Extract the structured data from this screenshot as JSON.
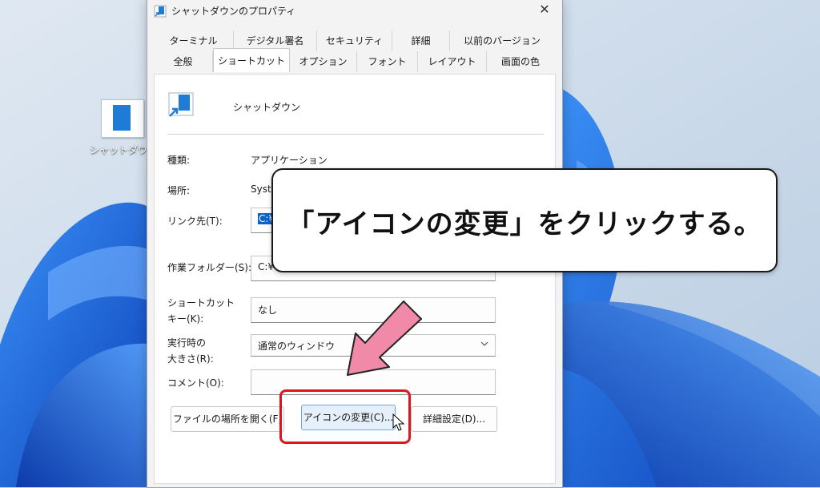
{
  "desktop": {
    "icon_label": "シャットダウン"
  },
  "dialog": {
    "title": "シャットダウンのプロパティ",
    "close_glyph": "✕",
    "tabs_back": [
      "ターミナル",
      "デジタル署名",
      "セキュリティ",
      "詳細",
      "以前のバージョン"
    ],
    "tabs_front": [
      "全般",
      "ショートカット",
      "オプション",
      "フォント",
      "レイアウト",
      "画面の色"
    ],
    "selected_tab": "ショートカット",
    "shortcut_name": "シャットダウン",
    "fields": {
      "type_label": "種類:",
      "type_value": "アプリケーション",
      "location_label": "場所:",
      "location_value": "Syste",
      "target_label": "リンク先(T):",
      "target_value": "C:¥W",
      "startin_label": "作業フォルダー(S):",
      "startin_value": "C:¥W",
      "hotkey_label_1": "ショートカット",
      "hotkey_label_2": "キー(K):",
      "hotkey_value": "なし",
      "run_label_1": "実行時の",
      "run_label_2": "大きさ(R):",
      "run_value": "通常のウィンドウ",
      "comment_label": "コメント(O):",
      "comment_value": ""
    },
    "buttons": {
      "open_location": "ファイルの場所を開く(F)",
      "change_icon": "アイコンの変更(C)...",
      "advanced": "詳細設定(D)..."
    }
  },
  "callout": {
    "text": "「アイコンの変更」をクリックする。"
  },
  "colors": {
    "accent_blue": "#1f7bd6",
    "highlight_red": "#e0141e",
    "arrow_pink": "#f08aa8",
    "selection_blue": "#0a64c8"
  }
}
